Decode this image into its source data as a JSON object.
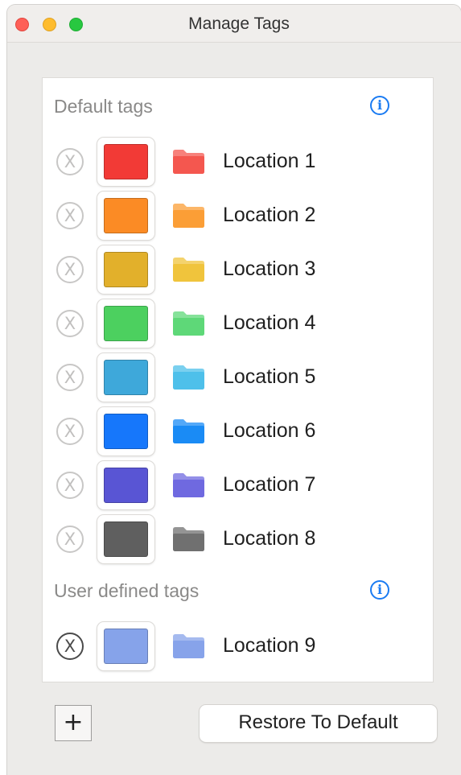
{
  "window": {
    "title": "Manage Tags"
  },
  "default_section": {
    "header": "Default tags",
    "tags": [
      {
        "label": "Location 1",
        "color": "#f23a36",
        "folder_color": "#f4574f"
      },
      {
        "label": "Location 2",
        "color": "#fb8b25",
        "folder_color": "#fb9e36"
      },
      {
        "label": "Location 3",
        "color": "#e2b02b",
        "folder_color": "#f0c43c"
      },
      {
        "label": "Location 4",
        "color": "#4cd05f",
        "folder_color": "#5ed878"
      },
      {
        "label": "Location 5",
        "color": "#3ea8da",
        "folder_color": "#4ec0ea"
      },
      {
        "label": "Location 6",
        "color": "#1677fb",
        "folder_color": "#1a8bf5"
      },
      {
        "label": "Location 7",
        "color": "#5955d4",
        "folder_color": "#6f69e0"
      },
      {
        "label": "Location 8",
        "color": "#5f5f5f",
        "folder_color": "#707070"
      }
    ]
  },
  "user_section": {
    "header": "User defined tags",
    "tags": [
      {
        "label": "Location 9",
        "color": "#86a3ea",
        "folder_color": "#87a3ea"
      }
    ]
  },
  "footer": {
    "add_label": "+",
    "restore_label": "Restore To Default"
  },
  "icons": {
    "info": "i",
    "remove": "X"
  }
}
